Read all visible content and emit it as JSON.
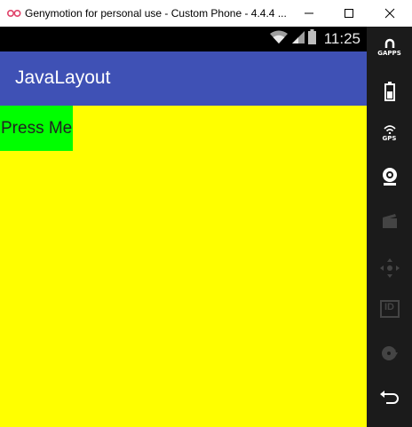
{
  "window": {
    "title": "Genymotion for personal use - Custom Phone - 4.4.4 ...",
    "minimize_icon": "minimize-icon",
    "maximize_icon": "maximize-icon",
    "close_icon": "close-icon"
  },
  "statusbar": {
    "time": "11:25",
    "icons": [
      "wifi-icon",
      "signal-icon",
      "battery-icon"
    ]
  },
  "appbar": {
    "title": "JavaLayout",
    "color": "#3f51b5"
  },
  "content": {
    "background": "#ffff00",
    "button_label": "Press Me",
    "button_color": "#00ff00"
  },
  "sidebar": {
    "gapps_label": "GAPPS",
    "gps_label": "GPS",
    "id_label": "ID",
    "items": [
      "gapps-icon",
      "battery-icon",
      "gps-icon",
      "webcam-icon",
      "clapperboard-icon",
      "dpad-icon",
      "id-icon",
      "disk-icon",
      "back-icon"
    ]
  }
}
